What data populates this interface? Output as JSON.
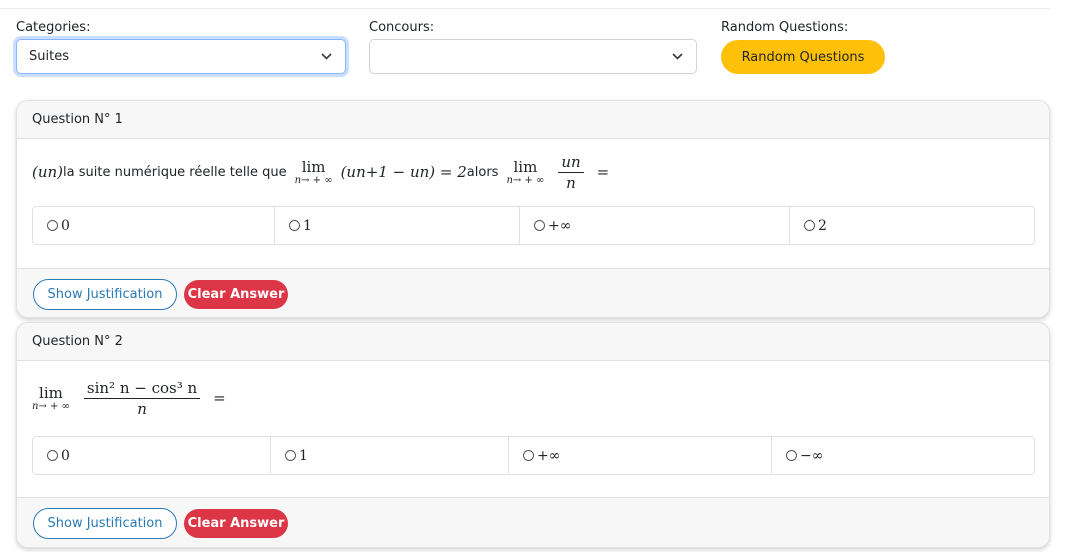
{
  "filters": {
    "categories": {
      "label": "Categories:",
      "value": "Suites"
    },
    "concours": {
      "label": "Concours:",
      "value": ""
    },
    "random": {
      "label": "Random Questions:",
      "button": "Random Questions"
    }
  },
  "icons": {
    "select_chevron": "chevron-down-icon",
    "radio": "radio-unchecked-icon"
  },
  "colors": {
    "random_button": "#ffc107",
    "clear_button": "#dc3545",
    "justification_button": "#2a7ab5",
    "select_focus": "#86b7fe"
  },
  "buttons": {
    "show_justification": "Show Justification",
    "clear_answer": "Clear Answer"
  },
  "questions": [
    {
      "header": "Question N° 1",
      "text": {
        "var": "(un)",
        "phrase": " la suite numérique réelle telle que ",
        "lim1": "lim",
        "lim1_sub": "n→ + ∞",
        "expr1": "(un+1 − un) = 2",
        "alors": " alors ",
        "lim2": "lim",
        "lim2_sub": "n→ + ∞",
        "frac_num": "un",
        "frac_den": "n",
        "eq": "="
      },
      "options": [
        "0",
        "1",
        "+∞",
        "2"
      ]
    },
    {
      "header": "Question N° 2",
      "text": {
        "lim": "lim",
        "lim_sub": "n→ + ∞",
        "frac_num": "sin² n − cos³ n",
        "frac_den": "n",
        "eq": "="
      },
      "options": [
        "0",
        "1",
        "+∞",
        "−∞"
      ]
    }
  ]
}
